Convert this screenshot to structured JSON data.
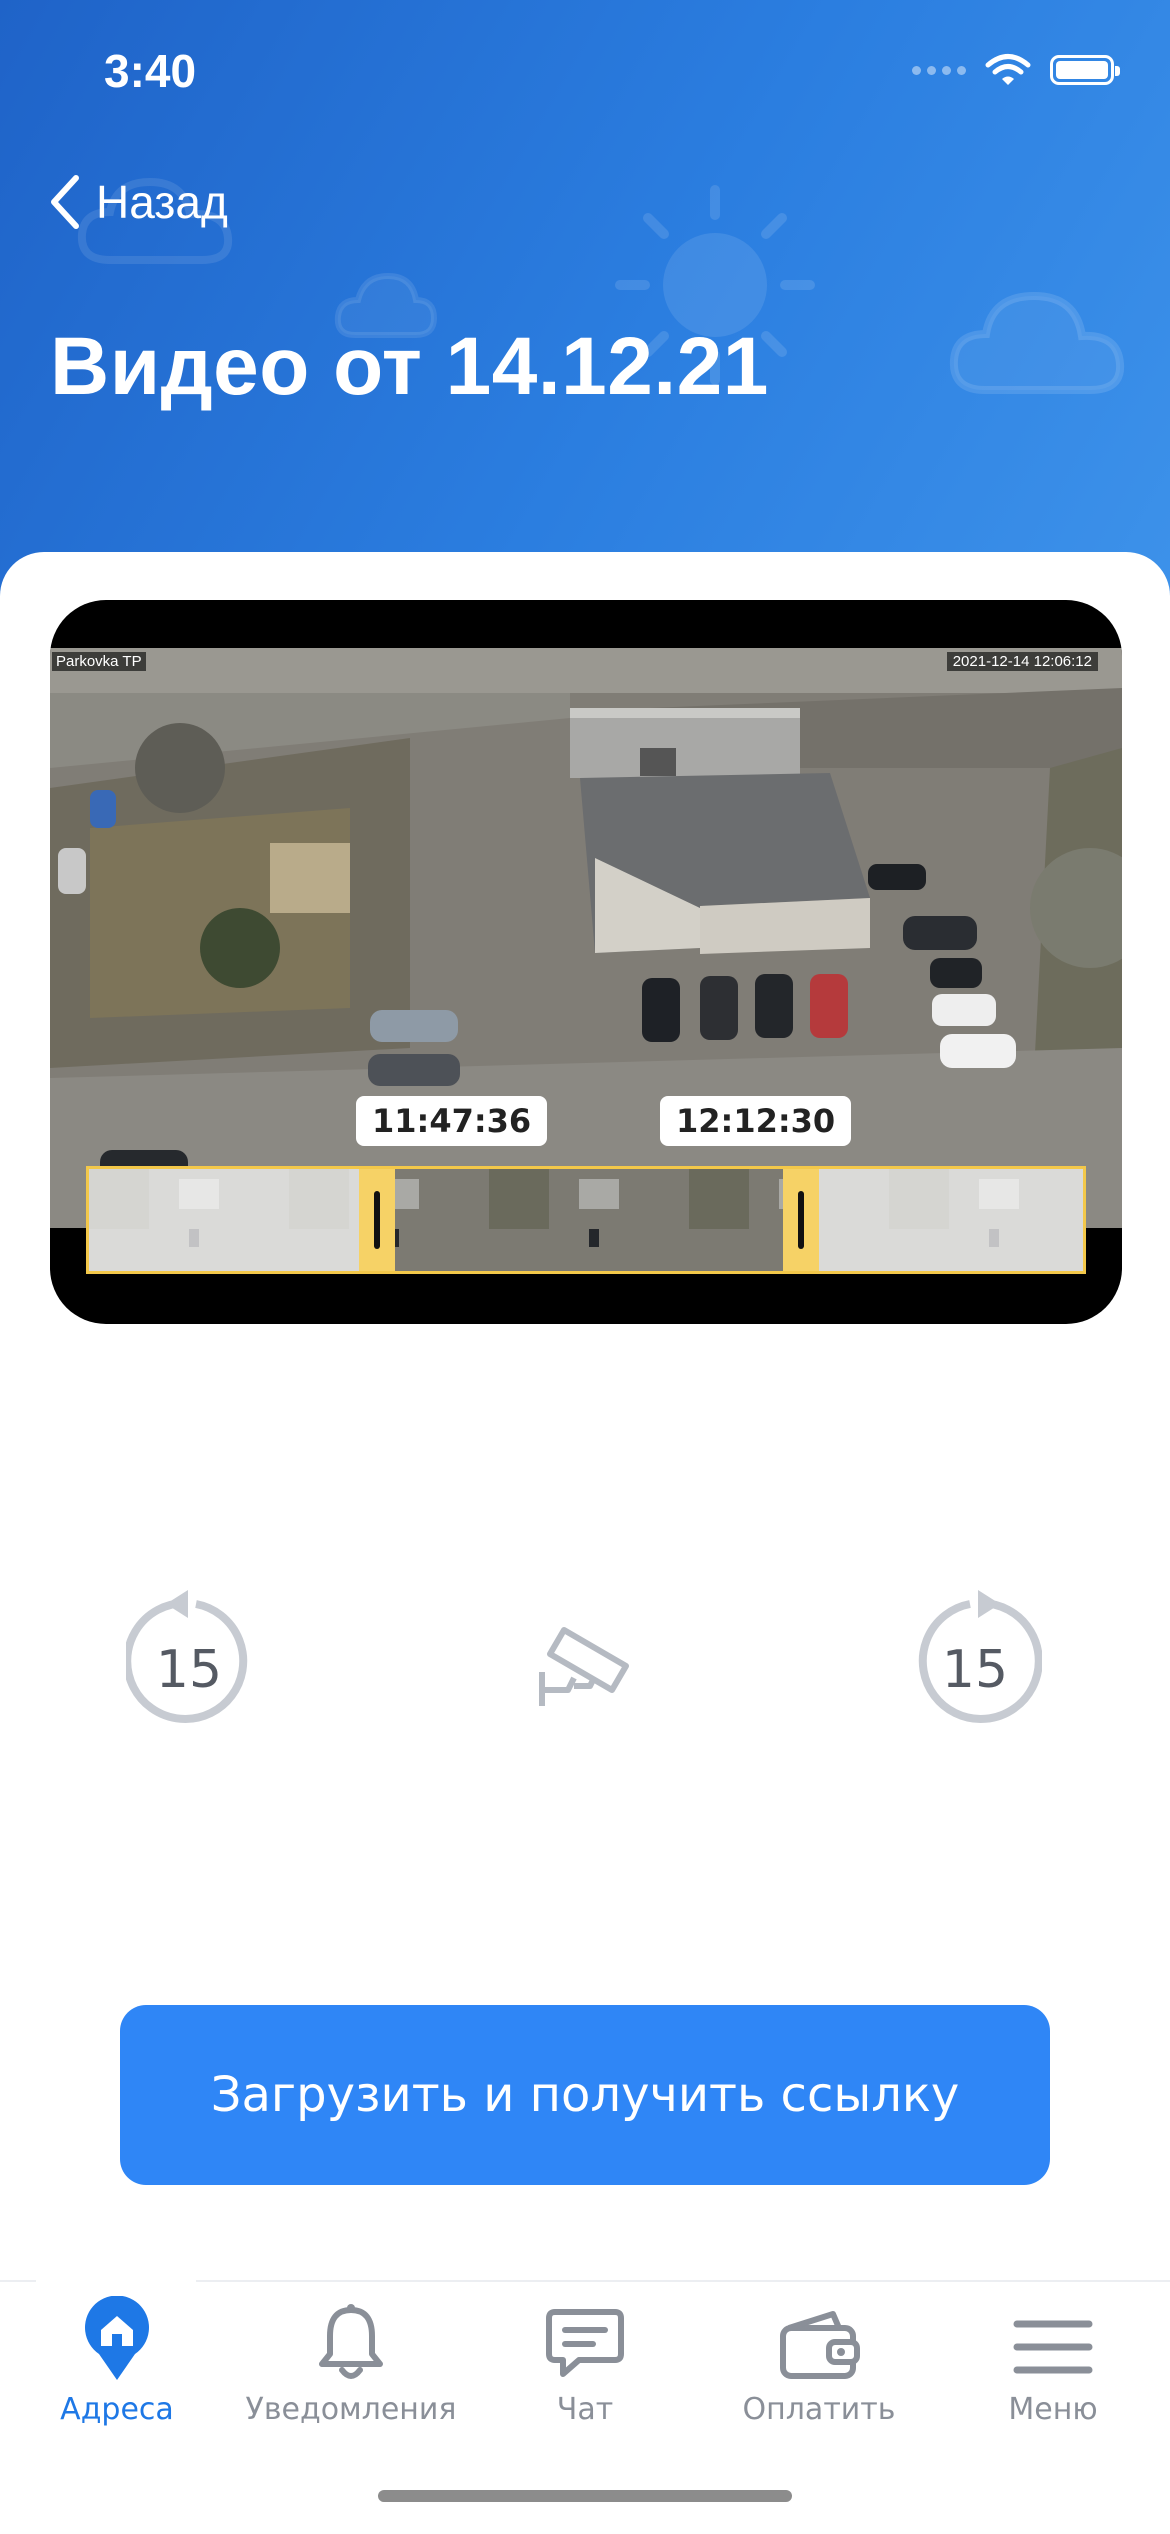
{
  "status_bar": {
    "time": "3:40",
    "signal_icon": "cellular-dots-icon",
    "wifi_icon": "wifi-icon",
    "battery_icon": "battery-icon"
  },
  "nav": {
    "back_label": "Назад",
    "back_icon": "chevron-left-icon"
  },
  "page": {
    "title": "Видео от 14.12.21"
  },
  "video": {
    "camera_name": "Parkovka TP",
    "timestamp": "2021-12-14 12:06:12",
    "trim_start_label": "11:47:36",
    "trim_end_label": "12:12:30",
    "accent_color": "#f3c84a"
  },
  "controls": {
    "rewind_seconds": "15",
    "forward_seconds": "15",
    "rewind_icon": "rewind-15-icon",
    "forward_icon": "forward-15-icon",
    "camera_icon": "cctv-camera-icon"
  },
  "actions": {
    "primary_label": "Загрузить и получить ссылку",
    "primary_color": "#2f86f6"
  },
  "tabbar": {
    "items": [
      {
        "label": "Адреса",
        "icon": "map-pin-home-icon",
        "active": true
      },
      {
        "label": "Уведомления",
        "icon": "bell-icon",
        "active": false
      },
      {
        "label": "Чат",
        "icon": "chat-bubble-icon",
        "active": false
      },
      {
        "label": "Оплатить",
        "icon": "wallet-icon",
        "active": false
      },
      {
        "label": "Меню",
        "icon": "hamburger-menu-icon",
        "active": false
      }
    ],
    "active_color": "#1e78e6",
    "inactive_color": "#8a8f98"
  }
}
